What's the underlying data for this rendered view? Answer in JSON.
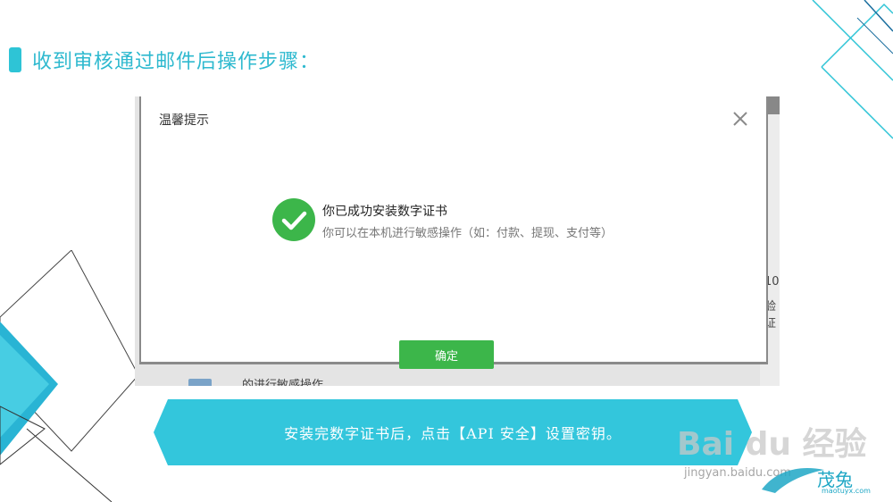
{
  "slide": {
    "title": "收到审核通过邮件后操作步骤：",
    "accent_color": "#2ec4d6"
  },
  "screenshot": {
    "background_fragments": {
      "right_text_1": "10",
      "right_text_2": "验证",
      "bottom_text": "的进行敏感操作"
    },
    "dialog": {
      "title": "温馨提示",
      "close_icon": "close-icon",
      "success_icon": "check-circle-icon",
      "message": "你已成功安装数字证书",
      "submessage": "你可以在本机进行敏感操作（如：付款、提现、支付等）",
      "confirm_label": "确定",
      "button_color": "#3cb64a"
    }
  },
  "banner": {
    "text": "安装完数字证书后，点击【API 安全】设置密钥。",
    "color": "#33c6dc"
  },
  "watermark": {
    "brand": "Bai du 经验",
    "url": "jingyan.baidu.com",
    "logo_text": "茂兔",
    "logo_url": "maotuyx.com"
  }
}
